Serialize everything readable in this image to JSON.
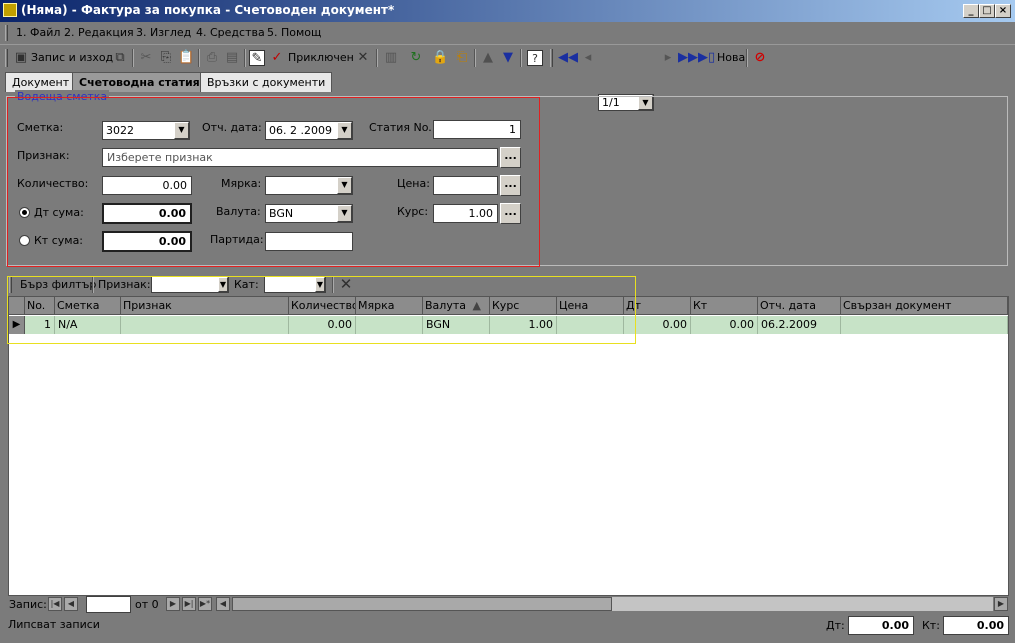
{
  "window": {
    "title": "(Няма) - Фактура за покупка - Счетоводен документ*"
  },
  "menu": [
    "1. Файл",
    "2. Редакция",
    "3. Изглед",
    "4. Средства",
    "5. Помощ"
  ],
  "toolbar": {
    "save_exit": "Запис и изход",
    "posted": "Приключен",
    "page_value": "1/1",
    "new": "Нова"
  },
  "tabs": [
    "Документ",
    "Счетоводна статия",
    "Връзки с документи"
  ],
  "lead_account": {
    "legend": "Водеща сметка",
    "account_label": "Сметка:",
    "account_value": "3022",
    "report_date_label": "Отч. дата:",
    "report_date_value": "06. 2 .2009",
    "entry_no_label": "Статия No.",
    "entry_no_value": "1",
    "attribute_label": "Признак:",
    "attribute_placeholder": "Изберете признак",
    "quantity_label": "Количество:",
    "quantity_value": "0.00",
    "unit_label": "Мярка:",
    "unit_value": "",
    "price_label": "Цена:",
    "price_value": "",
    "dt_label": "Дт сума:",
    "dt_value": "0.00",
    "currency_label": "Валута:",
    "currency_value": "BGN",
    "rate_label": "Курс:",
    "rate_value": "1.00",
    "kt_label": "Кт сума:",
    "kt_value": "0.00",
    "batch_label": "Партида:",
    "batch_value": ""
  },
  "filter": {
    "quick_filter": "Бърз филтър",
    "attribute_label": "Признак:",
    "cat_label": "Кат:"
  },
  "grid": {
    "columns": [
      "No.",
      "Сметка",
      "Признак",
      "Количество",
      "Мярка",
      "Валута",
      "Курс",
      "Цена",
      "Дт",
      "Кт",
      "Отч. дата",
      "Свързан документ"
    ],
    "row": {
      "no": "1",
      "account": "N/A",
      "attribute": "",
      "quantity": "0.00",
      "unit": "",
      "currency": "BGN",
      "rate": "1.00",
      "price": "",
      "dt": "0.00",
      "kt": "0.00",
      "date": "06.2.2009",
      "linked": ""
    }
  },
  "nav": {
    "record_label": "Запис:",
    "of_label": "от 0"
  },
  "status": {
    "message": "Липсват записи",
    "dt_label": "Дт:",
    "dt_value": "0.00",
    "kt_label": "Кт:",
    "kt_value": "0.00"
  },
  "colors": {
    "title_gradient_start": "#0a246a",
    "row_selected": "#c7e3c7",
    "annotation_red": "#e02020",
    "annotation_yellow": "#e8e020"
  }
}
